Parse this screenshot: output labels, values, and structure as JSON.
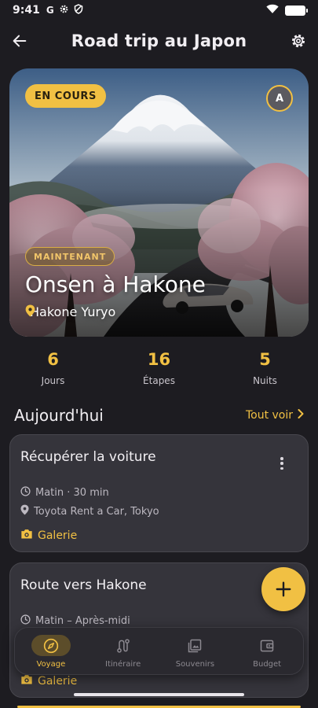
{
  "status_bar": {
    "time": "9:41",
    "icons": [
      "google-icon",
      "gear-icon",
      "shield-icon"
    ],
    "right_icons": [
      "wifi-icon",
      "battery-icon"
    ]
  },
  "app_bar": {
    "title": "Road trip au Japon",
    "back_icon": "arrow-left-icon",
    "settings_icon": "gear-icon"
  },
  "hero": {
    "status_label": "EN COURS",
    "avatar_initial": "A",
    "now_label": "MAINTENANT",
    "place_title": "Onsen à Hakone",
    "place_location": "Hakone Yuryo"
  },
  "stats": [
    {
      "value": "6",
      "label": "Jours"
    },
    {
      "value": "16",
      "label": "Étapes"
    },
    {
      "value": "5",
      "label": "Nuits"
    }
  ],
  "today": {
    "heading": "Aujourd'hui",
    "see_all": "Tout voir"
  },
  "cards": [
    {
      "title": "Récupérer la voiture",
      "time": "Matin · 30 min",
      "place": "Toyota Rent a Car, Tokyo",
      "gallery": "Galerie"
    },
    {
      "title": "Route vers Hakone",
      "time": "Matin – Après-midi",
      "gallery": "Galerie"
    }
  ],
  "nav": [
    {
      "label": "Voyage",
      "icon": "compass-icon",
      "active": true
    },
    {
      "label": "Itinéraire",
      "icon": "route-icon",
      "active": false
    },
    {
      "label": "Souvenirs",
      "icon": "photo-library-icon",
      "active": false
    },
    {
      "label": "Budget",
      "icon": "wallet-icon",
      "active": false
    }
  ],
  "colors": {
    "background": "#1d1c21",
    "accent": "#f1c043",
    "card": "#35343b"
  }
}
